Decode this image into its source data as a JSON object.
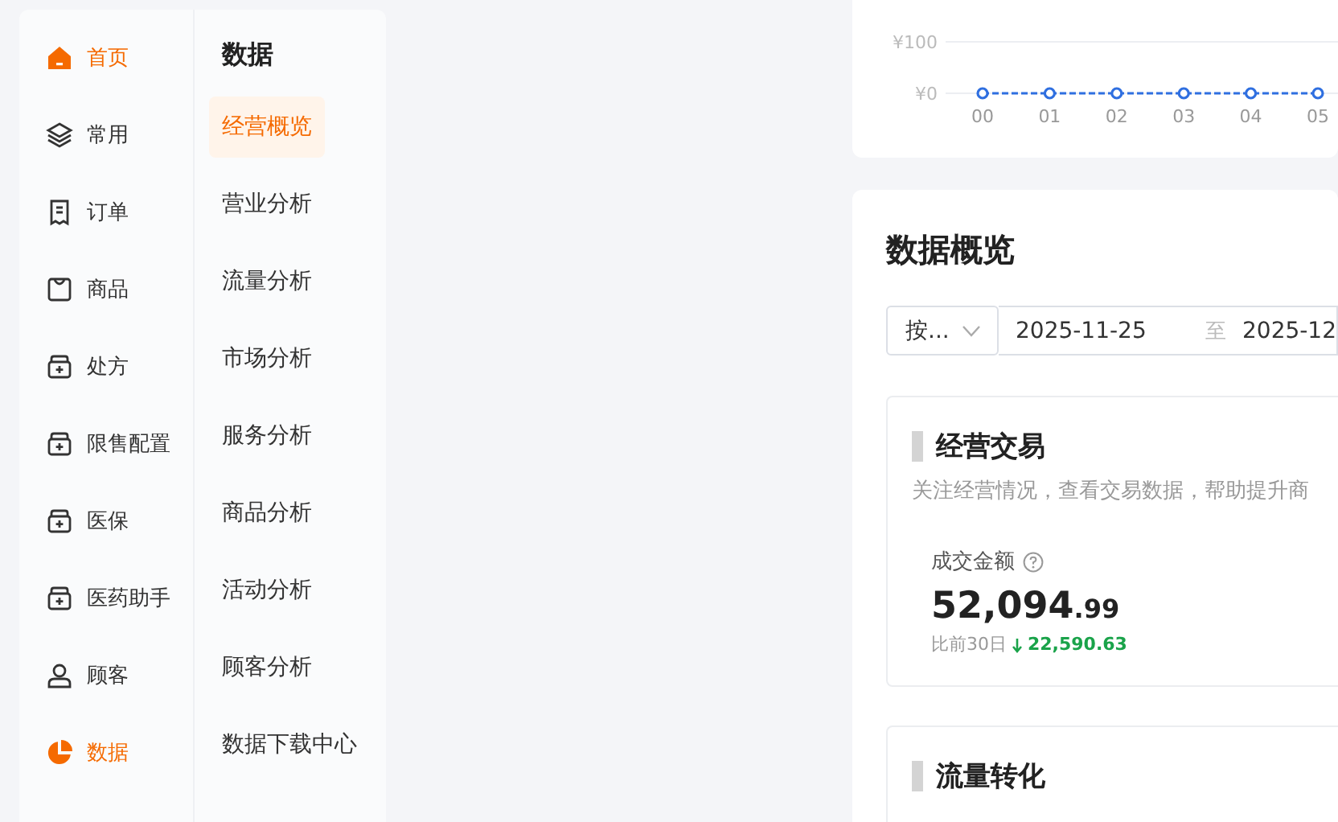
{
  "primary_nav": [
    {
      "label": "首页",
      "selected": true
    },
    {
      "label": "常用",
      "selected": false
    },
    {
      "label": "订单",
      "selected": false
    },
    {
      "label": "商品",
      "selected": false
    },
    {
      "label": "处方",
      "selected": false
    },
    {
      "label": "限售配置",
      "selected": false
    },
    {
      "label": "医保",
      "selected": false
    },
    {
      "label": "医药助手",
      "selected": false
    },
    {
      "label": "顾客",
      "selected": false
    },
    {
      "label": "数据",
      "selected": true
    }
  ],
  "secondary_nav": {
    "title": "数据",
    "items": [
      {
        "label": "经营概览",
        "selected": true
      },
      {
        "label": "营业分析",
        "selected": false
      },
      {
        "label": "流量分析",
        "selected": false
      },
      {
        "label": "市场分析",
        "selected": false
      },
      {
        "label": "服务分析",
        "selected": false
      },
      {
        "label": "商品分析",
        "selected": false
      },
      {
        "label": "活动分析",
        "selected": false
      },
      {
        "label": "顾客分析",
        "selected": false
      },
      {
        "label": "数据下载中心",
        "selected": false
      }
    ]
  },
  "trend_chart": {
    "chart_data": {
      "type": "line",
      "categories": [
        "00",
        "01",
        "02",
        "03",
        "04",
        "05"
      ],
      "series": [
        {
          "color": "#2f6fe0",
          "line_style": "dashed",
          "marker": "circle",
          "values": [
            0,
            0,
            0,
            0,
            0,
            0
          ]
        }
      ],
      "ylim": [
        0,
        100
      ],
      "yticks": [
        {
          "value": 0,
          "label": "¥0"
        },
        {
          "value": 100,
          "label": "¥100"
        }
      ]
    }
  },
  "overview": {
    "title": "数据概览",
    "period_select": "按...",
    "date_from": "2025-11-25",
    "range_separator": "至",
    "date_to": "2025-12",
    "sections": [
      {
        "title": "经营交易",
        "description": "关注经营情况，查看交易数据，帮助提升商",
        "metric": {
          "label": "成交金额",
          "value_integer": "52,094",
          "value_decimal": ".99",
          "compare_label": "比前30日",
          "compare_decrease": true,
          "compare_value": "22,590.63"
        }
      },
      {
        "title": "流量转化"
      }
    ]
  }
}
